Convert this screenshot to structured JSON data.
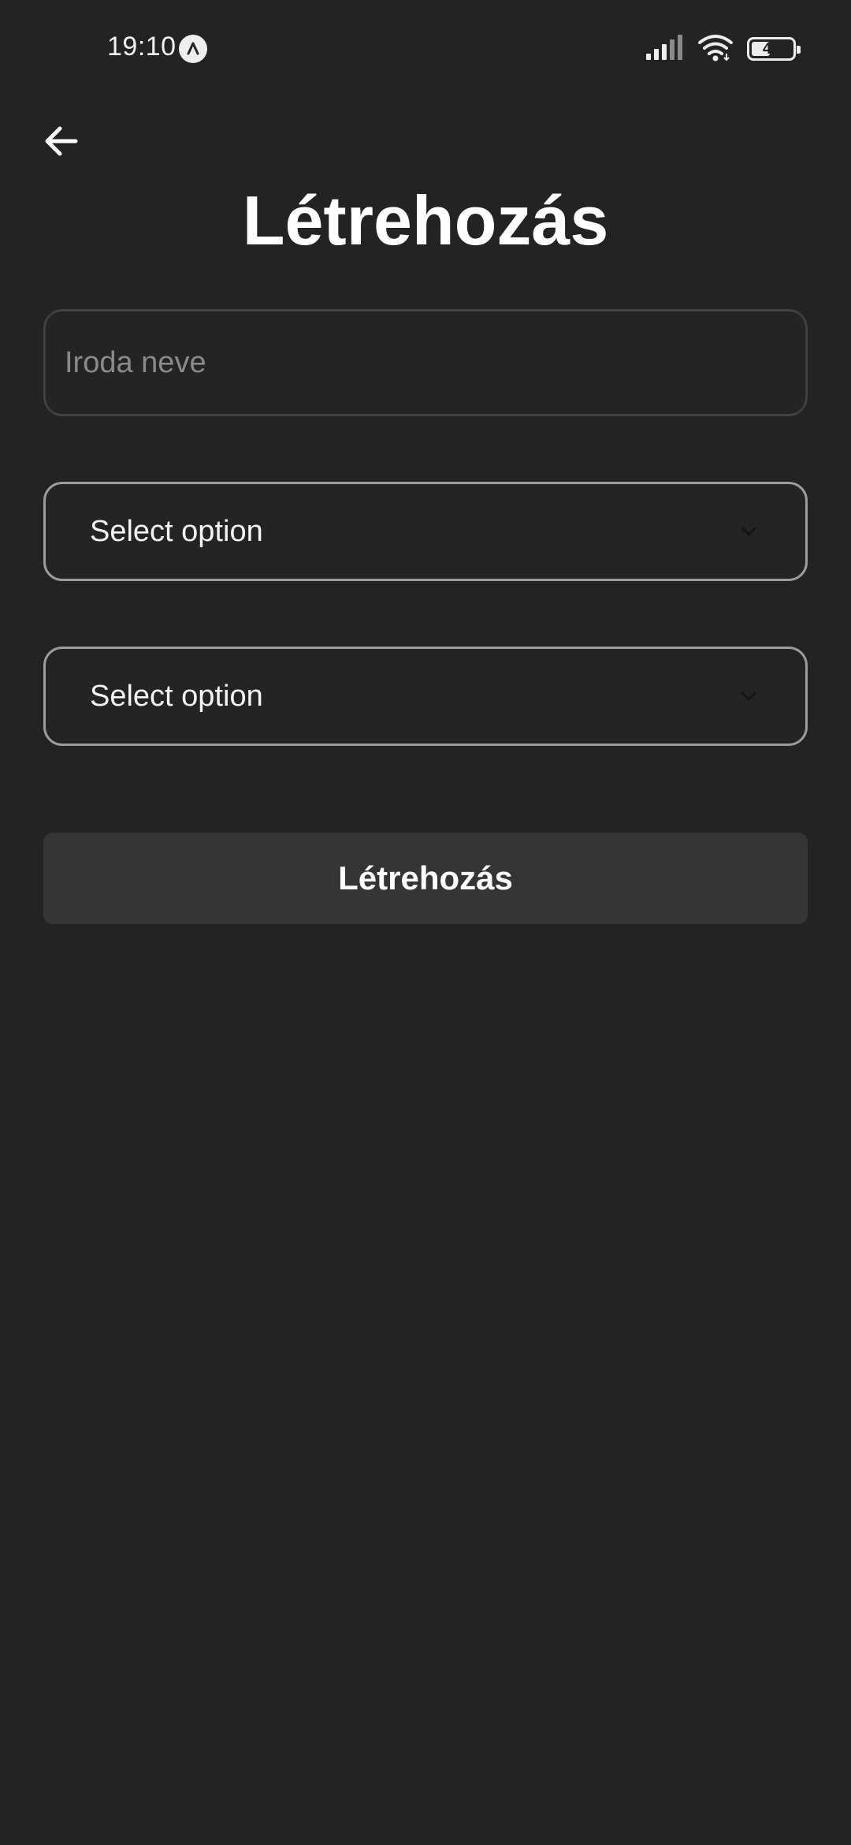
{
  "status_bar": {
    "time": "19:10",
    "app_icon": "app-notification-icon",
    "signal_icon": "cellular-signal-icon",
    "wifi_icon": "wifi-icon",
    "battery_level": "46",
    "battery_percent": 46
  },
  "header": {
    "back_icon": "arrow-left-icon",
    "title": "Létrehozás"
  },
  "form": {
    "office_name": {
      "placeholder": "Iroda neve",
      "value": ""
    },
    "select_1": {
      "label": "Select option",
      "icon": "chevron-down-icon"
    },
    "select_2": {
      "label": "Select option",
      "icon": "chevron-down-icon"
    },
    "submit_label": "Létrehozás"
  },
  "colors": {
    "background": "#232323",
    "input_border": "#414141",
    "select_border": "#9c9c9c",
    "button_background": "#353535",
    "text": "#ffffff",
    "placeholder": "#8a8a8a"
  }
}
